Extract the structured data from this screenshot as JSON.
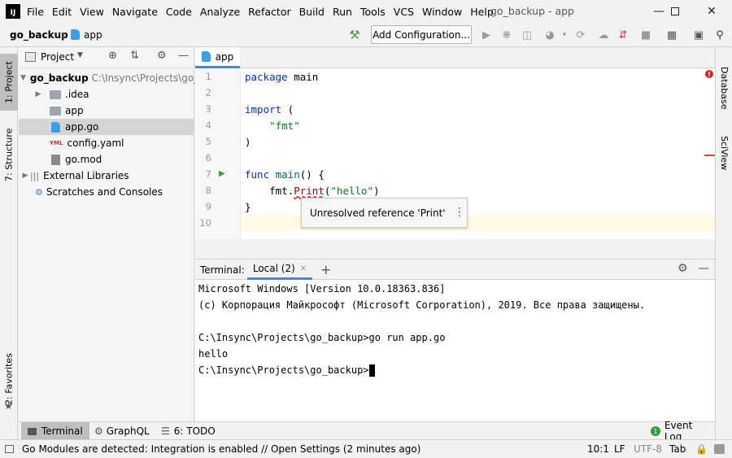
{
  "menu": {
    "logo": "IJ",
    "items": [
      "File",
      "Edit",
      "View",
      "Navigate",
      "Code",
      "Analyze",
      "Refactor",
      "Build",
      "Run",
      "Tools",
      "VCS",
      "Window",
      "Help"
    ],
    "window_title": "go_backup - app"
  },
  "navbar": {
    "project_crumb": "go_backup",
    "file_crumb": "app",
    "add_configuration": "Add Configuration..."
  },
  "left_tabs": {
    "project": "1: Project",
    "structure": "7: Structure",
    "favorites": "2: Favorites"
  },
  "right_tabs": {
    "database": "Database",
    "sciview": "SciView"
  },
  "project_panel": {
    "title": "Project",
    "root_name": "go_backup",
    "root_path": "C:\\Insync\\Projects\\go_backup",
    "items": [
      {
        "label": "go_backup"
      },
      {
        "label": ".idea"
      },
      {
        "label": "app"
      },
      {
        "label": "app.go"
      },
      {
        "label": "config.yaml"
      },
      {
        "label": "go.mod"
      },
      {
        "label": "External Libraries"
      },
      {
        "label": "Scratches and Consoles"
      }
    ]
  },
  "editor": {
    "tab_label": "app",
    "line_numbers": [
      "1",
      "2",
      "3",
      "4",
      "5",
      "6",
      "7",
      "8",
      "9",
      "10"
    ],
    "code": {
      "l1_kw": "package",
      "l1_rest": " main",
      "l3_kw": "import",
      "l3_rest": " (",
      "l4": "    \"fmt\"",
      "l5": ")",
      "l7_kw": "func",
      "l7_fn": " main",
      "l7_rest": "() {",
      "l8_a": "    fmt.",
      "l8_fn": "Print",
      "l8_b": "(",
      "l8_str": "\"hello\"",
      "l8_c": ")",
      "l9": "}"
    },
    "error_mark": "!"
  },
  "tooltip": {
    "text": "Unresolved reference 'Print'"
  },
  "terminal": {
    "label": "Terminal:",
    "tab": "Local (2)",
    "lines": [
      "Microsoft Windows [Version 10.0.18363.836]",
      "(c) Корпорация Майкрософт (Microsoft Corporation), 2019. Все права защищены.",
      "",
      "C:\\Insync\\Projects\\go_backup>go run app.go",
      "hello",
      "C:\\Insync\\Projects\\go_backup>"
    ]
  },
  "tool_windows": {
    "terminal": "Terminal",
    "graphql": "GraphQL",
    "todo": "6: TODO",
    "event_log": "Event Log"
  },
  "status": {
    "message": "Go Modules are detected: Integration is enabled // Open Settings (2 minutes ago)",
    "position": "10:1",
    "line_sep": "LF",
    "encoding": "UTF-8",
    "indent": "Tab"
  }
}
